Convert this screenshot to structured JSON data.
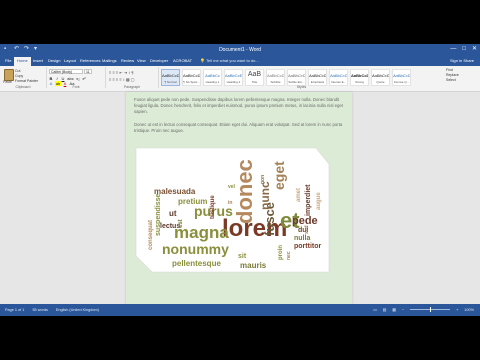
{
  "window": {
    "title": "Document1 - Word",
    "min": "—",
    "max": "□",
    "close": "✕",
    "qat_icons": [
      "save-icon",
      "undo-icon",
      "redo-icon",
      "customize-icon"
    ],
    "qat_glyphs": [
      "▪",
      "↶",
      "↷",
      "▾"
    ]
  },
  "tabs": [
    {
      "label": "File"
    },
    {
      "label": "Home"
    },
    {
      "label": "Insert"
    },
    {
      "label": "Design"
    },
    {
      "label": "Layout"
    },
    {
      "label": "References"
    },
    {
      "label": "Mailings"
    },
    {
      "label": "Review"
    },
    {
      "label": "View"
    },
    {
      "label": "Developer"
    },
    {
      "label": "ACROBAT"
    }
  ],
  "tell_me": "💡 Tell me what you want to do...",
  "ribbon_right": "Sign in   Share",
  "clipboard": {
    "paste": "Paste",
    "cut": "Cut",
    "copy": "Copy",
    "format_painter": "Format Painter",
    "label": "Clipboard"
  },
  "font": {
    "name": "Calibri (Body)",
    "size": "11",
    "label": "Font",
    "row1": [
      "B",
      "I",
      "U",
      "abc",
      "x₂",
      "x²"
    ],
    "row2": [
      "A",
      "ab",
      "A",
      "Aa"
    ]
  },
  "paragraph": {
    "label": "Paragraph",
    "row1": "≡ ≡ ≡ ⇤ ⇥ ↕ ¶",
    "row2": "≡ ≡ ≡ ≡ ↕ ▦ ▢"
  },
  "styles": {
    "label": "Styles",
    "items": [
      {
        "sample": "AaBbCcDc",
        "name": "¶ Normal"
      },
      {
        "sample": "AaBbCcDc",
        "name": "¶ No Spac..."
      },
      {
        "sample": "AaBbCc",
        "name": "Heading 1"
      },
      {
        "sample": "AaBbCcE",
        "name": "Heading 2"
      },
      {
        "sample": "AaB",
        "name": "Title"
      },
      {
        "sample": "AaBbCcD",
        "name": "Subtitle"
      },
      {
        "sample": "AaBbCcDc",
        "name": "Subtle Em..."
      },
      {
        "sample": "AaBbCcDc",
        "name": "Emphasis"
      },
      {
        "sample": "AaBbCcDc",
        "name": "Intense E..."
      },
      {
        "sample": "AaBbCcDc",
        "name": "Strong"
      },
      {
        "sample": "AaBbCcDc",
        "name": "Quote"
      },
      {
        "sample": "AaBbCcDc",
        "name": "Intense Q..."
      }
    ]
  },
  "editing": {
    "find": "Find",
    "replace": "Replace",
    "select": "Select",
    "label": "Editing"
  },
  "document": {
    "para1": "Fusce aliquet pede non pede. Suspendisse dapibus lorem pellentesque magna. Integer nulla. Donec blandit feugiat ligula. Donec hendrerit, felis et imperdiet euismod, purus ipsum pretium metus, in lacinia nulla nisl eget sapien.",
    "para2": "Donec ut est in lectus consequat consequat. Etiam eget dui. Aliquam erat volutpat. Sed at lorem in nunc porta tristique. Proin nec augue."
  },
  "word_cloud": {
    "words": [
      {
        "text": "lorem",
        "color": "#7b3a26"
      },
      {
        "text": "donec",
        "color": "#b5895e"
      },
      {
        "text": "magna",
        "color": "#8a8f3c"
      },
      {
        "text": "nonummy",
        "color": "#8a8f3c"
      },
      {
        "text": "et",
        "color": "#7f8a3a"
      },
      {
        "text": "purus",
        "color": "#8a8f3c"
      },
      {
        "text": "fusce",
        "color": "#6b5a3a"
      },
      {
        "text": "eget",
        "color": "#a38257"
      },
      {
        "text": "nunc",
        "color": "#8a6a48"
      },
      {
        "text": "pede",
        "color": "#6a3a2a"
      },
      {
        "text": "pretium",
        "color": "#8a8f3c"
      },
      {
        "text": "malesuada",
        "color": "#7a5030"
      },
      {
        "text": "pellentesque",
        "color": "#8a8f3c"
      },
      {
        "text": "mauris",
        "color": "#7a7a3a"
      },
      {
        "text": "sit",
        "color": "#8a8f3c"
      },
      {
        "text": "porttitor",
        "color": "#7b3a26"
      },
      {
        "text": "nulla",
        "color": "#7a7a3a"
      },
      {
        "text": "dui",
        "color": "#6a4a2a"
      },
      {
        "text": "imperdiet",
        "color": "#6a3a2a"
      },
      {
        "text": "suspendisse",
        "color": "#8a8f3c"
      },
      {
        "text": "consequat",
        "color": "#b5895e"
      },
      {
        "text": "tristique",
        "color": "#7a3a26"
      },
      {
        "text": "lectus",
        "color": "#5a3a2a"
      },
      {
        "text": "ut",
        "color": "#5a3a2a"
      },
      {
        "text": "est",
        "color": "#7a7a3a"
      },
      {
        "text": "amet",
        "color": "#c9a882"
      },
      {
        "text": "augue",
        "color": "#c9a882"
      },
      {
        "text": "proin",
        "color": "#8a8f3c"
      },
      {
        "text": "nec",
        "color": "#a38257"
      },
      {
        "text": "non",
        "color": "#7a7a3a"
      },
      {
        "text": "vel",
        "color": "#8a8f3c"
      },
      {
        "text": "in",
        "color": "#a38257"
      },
      {
        "text": "sed",
        "color": "#b5895e"
      }
    ]
  },
  "status": {
    "page": "Page 1 of 1",
    "words": "55 words",
    "lang": "English (United Kingdom)",
    "zoom": "100%"
  }
}
